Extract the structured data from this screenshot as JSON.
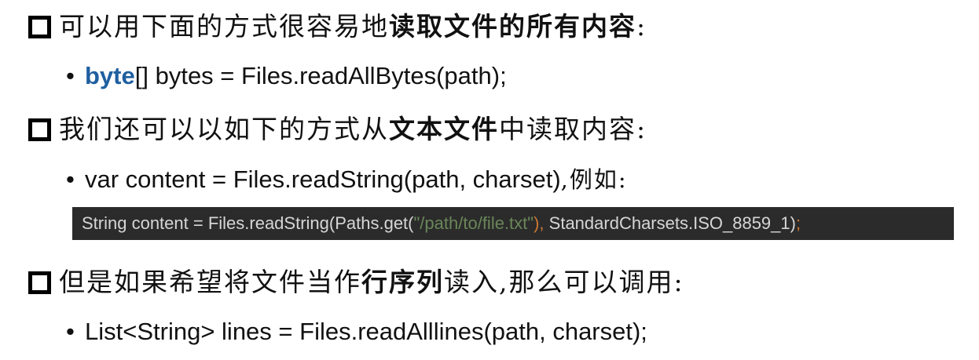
{
  "sections": [
    {
      "heading": {
        "before": "可以用下面的方式很容易地",
        "emphasis": "读取文件的所有内容",
        "after": ":"
      },
      "bullet": {
        "keyword": "byte",
        "rest": "[] bytes = Files.readAllBytes(path);"
      }
    },
    {
      "heading": {
        "before": "我们还可以以如下的方式从",
        "emphasis": "文本文件",
        "after": "中读取内容:"
      },
      "bullet": {
        "code": "var content = Files.readString(path, charset)",
        "note": ",例如:"
      },
      "code_example": {
        "part1": "String content = Files.readString(Paths.get(",
        "string_literal": "\"/path/to/file.txt\"",
        "comma": "),",
        "part2": " StandardCharsets.ISO_8859_1)",
        "semicolon": ";"
      }
    },
    {
      "heading": {
        "before": "但是如果希望将文件当作",
        "emphasis": "行序列",
        "after": "读入,那么可以调用:"
      },
      "bullet": {
        "code": "List<String> lines = Files.readAlllines(path, charset);"
      }
    }
  ],
  "bullet_symbol": "•",
  "colors": {
    "keyword": "#1f5fa0",
    "code_background": "#2b2b2b",
    "code_text": "#d6d6d6",
    "code_string": "#6a8759",
    "code_punctuation": "#cc7832"
  }
}
